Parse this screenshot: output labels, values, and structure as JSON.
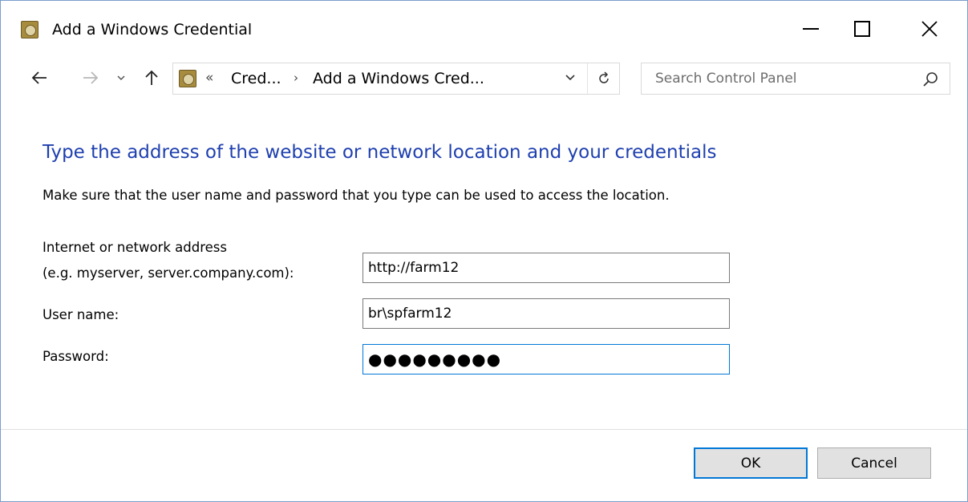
{
  "window": {
    "title": "Add a Windows Credential",
    "icon": "credential-manager-icon"
  },
  "nav": {
    "back_icon": "arrow-left-icon",
    "forward_icon": "arrow-right-icon",
    "recent_icon": "chevron-down-icon",
    "up_icon": "arrow-up-icon"
  },
  "address_bar": {
    "overflow": "«",
    "breadcrumbs": [
      {
        "label": "Cred..."
      },
      {
        "label": "Add a Windows Cred..."
      }
    ],
    "separator": "›"
  },
  "search": {
    "placeholder": "Search Control Panel"
  },
  "content": {
    "heading": "Type the address of the website or network location and your credentials",
    "subtext": "Make sure that the user name and password that you type can be used to access the location.",
    "address_label": "Internet or network address",
    "address_hint": "(e.g. myserver, server.company.com):",
    "address_value": "http://farm12",
    "user_label": "User name:",
    "user_value": "br\\spfarm12",
    "password_label": "Password:",
    "password_value": "●●●●●●●●●"
  },
  "footer": {
    "ok_label": "OK",
    "cancel_label": "Cancel"
  },
  "colors": {
    "heading": "#1e3faf",
    "focus_border": "#0078d7",
    "window_border": "#7a9ccc"
  }
}
